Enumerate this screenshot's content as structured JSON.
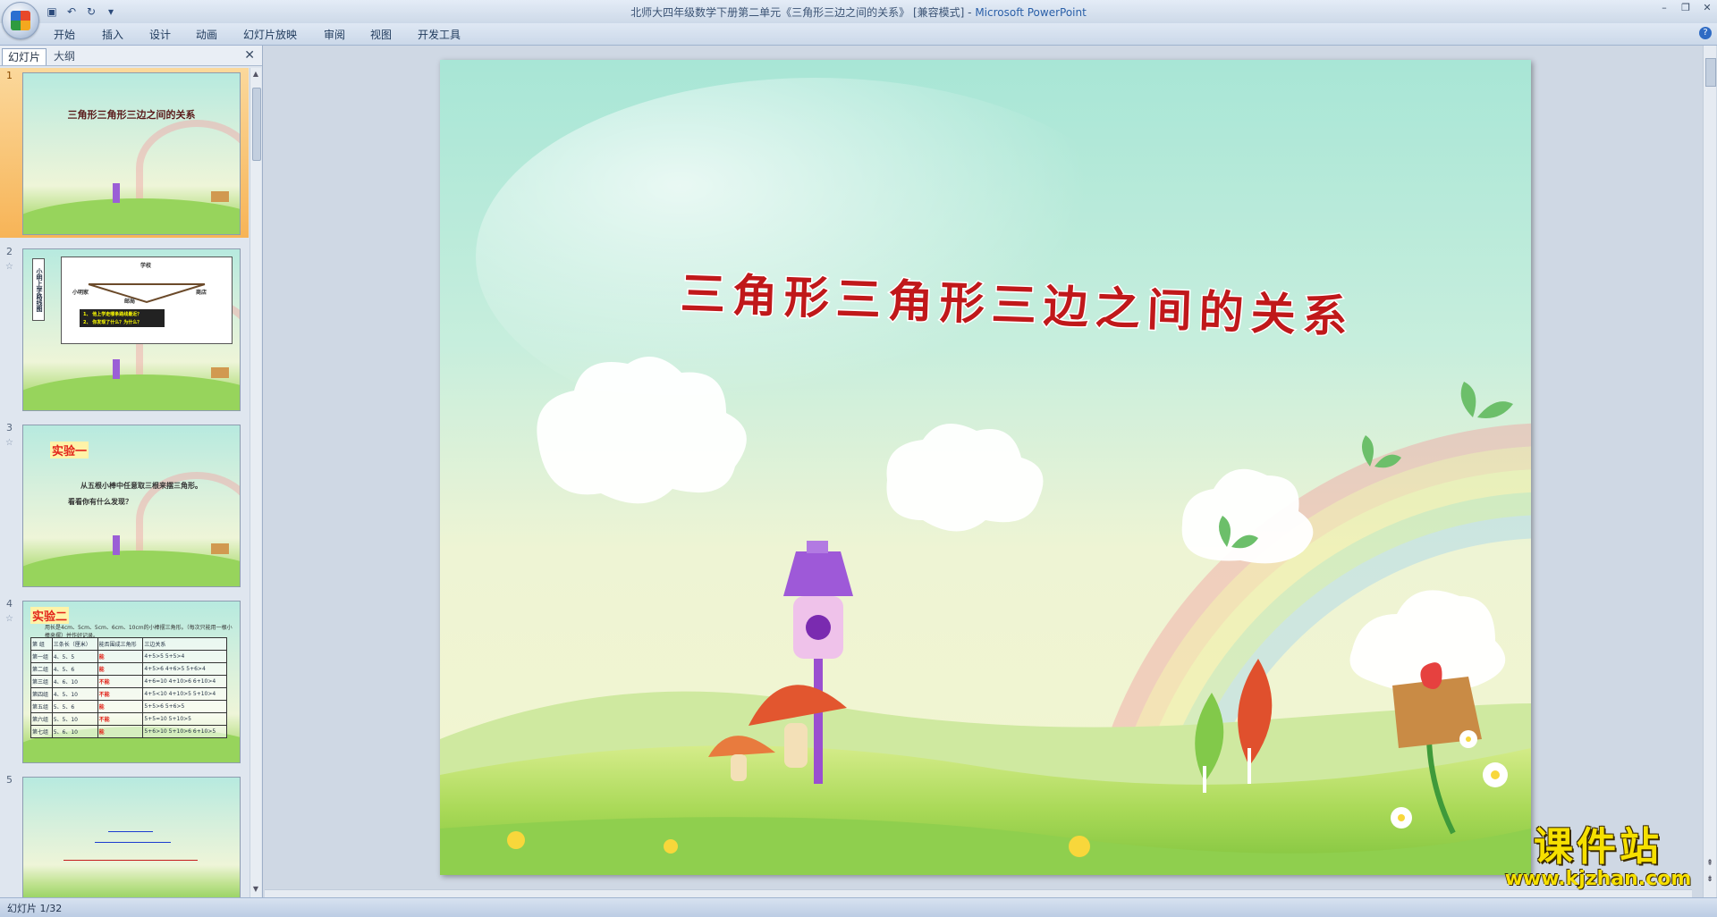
{
  "window": {
    "title_doc": "北师大四年级数学下册第二单元《三角形三边之间的关系》 [兼容模式] - ",
    "title_app": "Microsoft PowerPoint",
    "controls": [
      "–",
      "❐",
      "✕"
    ]
  },
  "quick_access": {
    "icons": [
      "save-icon",
      "undo-icon",
      "redo-icon",
      "customize-icon"
    ]
  },
  "ribbon": {
    "tabs": [
      "开始",
      "插入",
      "设计",
      "动画",
      "幻灯片放映",
      "审阅",
      "视图",
      "开发工具"
    ],
    "help": "?"
  },
  "left_pane": {
    "tab_slides": "幻灯片",
    "tab_outline": "大纲",
    "close": "✕",
    "slides": [
      {
        "number": "1",
        "title": "三角形三角形三边之间的关系",
        "selected": true
      },
      {
        "number": "2",
        "side_label": "小明上学路线图",
        "question1": "1、 他上学走哪条路线最近？",
        "question2": "2、 你发现了什么？为什么？",
        "places": [
          "学校",
          "邮局",
          "小明家",
          "商店"
        ]
      },
      {
        "number": "3",
        "heading": "实验一",
        "line1": "从五根小棒中任意取三根来摆三角形。",
        "line2": "看看你有什么发现？"
      },
      {
        "number": "4",
        "heading": "实验二",
        "intro": "用长是4cm、5cm、5cm、6cm、10cm的小棒摆三角形。（每次只能用一根小棒来摆）并作好记录。",
        "table_header": [
          "第 组",
          "三条长（厘米）",
          "能否围成三角形",
          "三边关系"
        ],
        "table_rows": [
          [
            "第一组",
            "4、5、5",
            "能",
            "4+5>5  5+5>4"
          ],
          [
            "第二组",
            "4、5、6",
            "能",
            "4+5>6  4+6>5  5+6>4"
          ],
          [
            "第三组",
            "4、6、10",
            "不能",
            "4+6=10  4+10>6  6+10>4"
          ],
          [
            "第四组",
            "4、5、10",
            "不能",
            "4+5<10  4+10>5  5+10>4"
          ],
          [
            "第五组",
            "5、5、6",
            "能",
            "5+5>6  5+6>5"
          ],
          [
            "第六组",
            "5、5、10",
            "不能",
            "5+5=10  5+10>5"
          ],
          [
            "第七组",
            "5、6、10",
            "能",
            "5+6>10  5+10>6  6+10>5"
          ]
        ]
      },
      {
        "number": "5"
      }
    ]
  },
  "slide": {
    "title": "三角形三角形三边之间的关系",
    "title_color": "#c0181a"
  },
  "watermark": {
    "main": "课件站",
    "url": "www.kjzhan.com"
  },
  "status": {
    "text": "幻灯片 1/32"
  }
}
